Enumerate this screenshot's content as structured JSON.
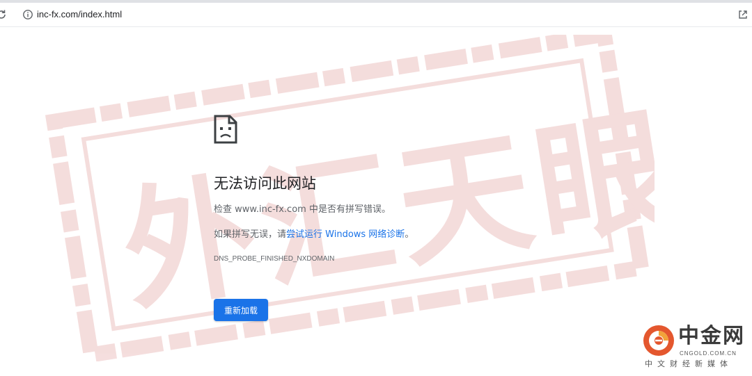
{
  "browser": {
    "url": "inc-fx.com/index.html"
  },
  "icons": {
    "reload": "reload-icon",
    "info": "info-icon",
    "share": "share-icon",
    "error_page": "sad-page-icon"
  },
  "error": {
    "title": "无法访问此网站",
    "line1": "检查 www.inc-fx.com 中是否有拼写错误。",
    "line2_prefix": "如果拼写无误，请",
    "line2_link": "尝试运行 Windows 网络诊断",
    "line2_suffix": "。",
    "code": "DNS_PROBE_FINISHED_NXDOMAIN",
    "reload_label": "重新加载"
  },
  "watermark": {
    "text": "外汇天眼",
    "color": "#c0302f"
  },
  "logo": {
    "name": "中金网",
    "domain": "CNGOLD.COM.CN",
    "tagline": "中文财经新媒体",
    "accent": "#e4572e"
  },
  "colors": {
    "accent": "#1a73e8",
    "text_primary": "#202124",
    "text_secondary": "#5f6368"
  }
}
